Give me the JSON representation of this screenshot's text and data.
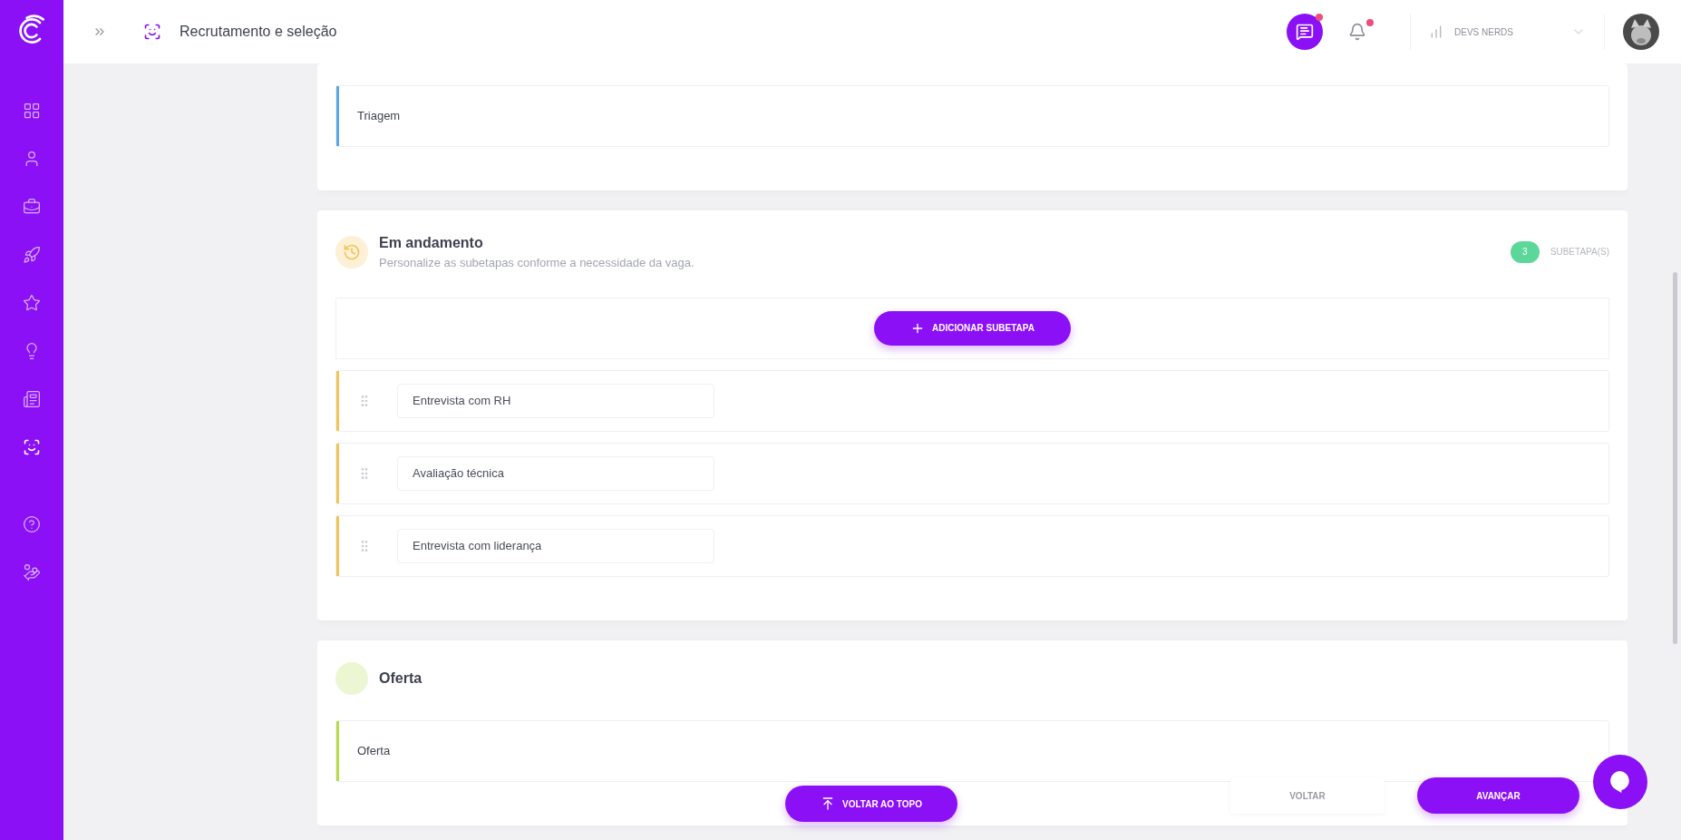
{
  "sidebar": {
    "items": [
      {
        "selected": false
      },
      {
        "selected": false
      },
      {
        "selected": false
      },
      {
        "selected": false
      },
      {
        "selected": false
      },
      {
        "selected": false
      },
      {
        "selected": false
      },
      {
        "selected": true
      },
      {
        "selected": false
      },
      {
        "selected": false
      }
    ]
  },
  "topbar": {
    "title": "Recrutamento e seleção",
    "messages_unread": true,
    "notifications_unread": true,
    "organization": "DEVS NERDS"
  },
  "stages": [
    {
      "kind": "plain",
      "color": "#5aa7e8",
      "steps": [
        {
          "kind": "fixed",
          "label": "Triagem"
        }
      ]
    },
    {
      "kind": "custom",
      "title": "Em andamento",
      "subtitle": "Personalize as subetapas conforme a necessidade da vaga.",
      "count": "3",
      "count_label": "SUBETAPA(S)",
      "add_label": "ADICIONAR SUBETAPA",
      "color": "#f3c45a",
      "steps": [
        {
          "kind": "draggable",
          "label": "Entrevista com RH"
        },
        {
          "kind": "draggable",
          "label": "Avaliação técnica"
        },
        {
          "kind": "draggable",
          "label": "Entrevista com liderança"
        }
      ]
    },
    {
      "kind": "simple",
      "title": "Oferta",
      "color": "#b5dc4a",
      "steps": [
        {
          "kind": "fixed",
          "label": "Oferta"
        }
      ]
    }
  ],
  "footer": {
    "top_button": "VOLTAR AO TOPO",
    "back_button": "VOLTAR",
    "next_button": "AVANÇAR"
  }
}
